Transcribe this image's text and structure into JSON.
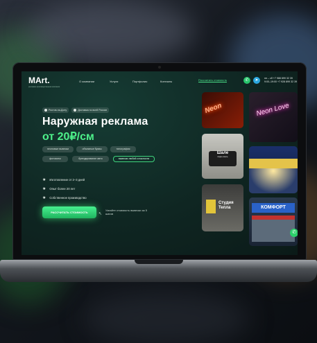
{
  "site": {
    "logo": "MArt.",
    "logo_sub": "рекламно-производственная компания",
    "menu": [
      "О компании",
      "Услуги",
      "Портфолио",
      "Контакты"
    ],
    "cta_link": "Рассчитать стоимость",
    "phones": [
      "+7 988 899 32 39",
      "+7 928 899 32 39"
    ],
    "phone_labels": [
      "пн – сб",
      "9:00–19:00"
    ]
  },
  "hero": {
    "locations": [
      "Ростов-на-Дону",
      "Доставка по всей России"
    ],
    "title_line1": "Наружная реклама",
    "title_line2": "от 20₽/см",
    "chips": [
      "неоновые вывески",
      "объемные буквы",
      "типография",
      "фотозоны",
      "брендирование авто",
      "вывески любой сложности"
    ],
    "active_chip_index": 5,
    "features": [
      "Изготовление от 2–3 дней",
      "Опыт более 20 лет",
      "Собственное производство"
    ],
    "button_label": "РАССЧИТАТЬ СТОИМОСТЬ",
    "button_note": "Узнайте стоимость вывески за 5 шагов"
  },
  "gallery": {
    "g1_text": "Neon",
    "g2_title": "Шале",
    "g2_sub": "парк-отель",
    "g3_text": "Студия Тепла",
    "g4_text": "Neon Love",
    "g6_text": "КОМФОРТ"
  },
  "colors": {
    "accent": "#4df08a",
    "screen_bg": "#0f2622"
  }
}
